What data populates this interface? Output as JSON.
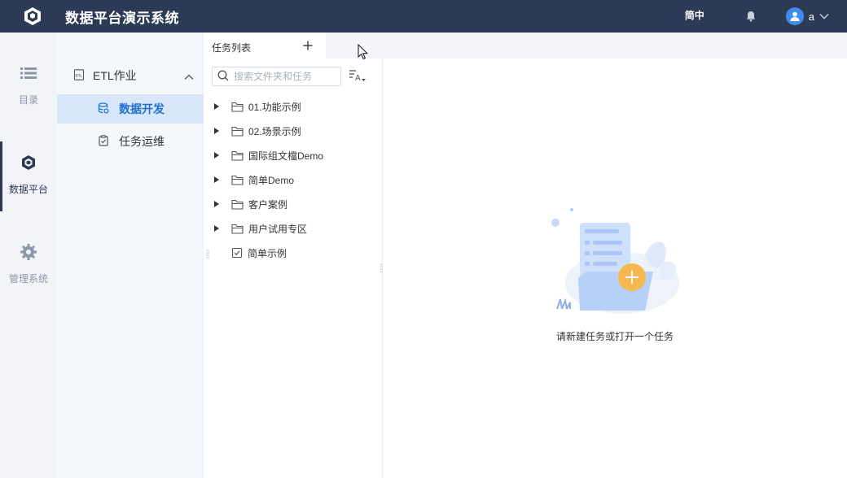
{
  "app": {
    "title": "数据平台演示系统",
    "logo_icon": "cube-logo-icon"
  },
  "header": {
    "language": "简中",
    "bell_icon": "bell-icon",
    "user_name": "a"
  },
  "rail": {
    "items": [
      {
        "label": "目录",
        "icon": "list-icon"
      },
      {
        "label": "数据平台",
        "icon": "cubes-icon",
        "active": true
      },
      {
        "label": "管理系统",
        "icon": "gear-icon"
      }
    ]
  },
  "subnav": {
    "group": {
      "label": "ETL作业",
      "icon": "etl-doc-icon",
      "expanded": true
    },
    "items": [
      {
        "label": "数据开发",
        "icon": "database-icon",
        "active": true
      },
      {
        "label": "任务运维",
        "icon": "clipboard-icon"
      }
    ]
  },
  "taskpanel": {
    "title": "任务列表",
    "search_placeholder": "搜索文件夹和任务",
    "tree": [
      {
        "label": "01.功能示例",
        "type": "folder"
      },
      {
        "label": "02.场景示例",
        "type": "folder"
      },
      {
        "label": "国际组文檔Demo",
        "type": "folder"
      },
      {
        "label": "简单Demo",
        "type": "folder"
      },
      {
        "label": "客户案例",
        "type": "folder"
      },
      {
        "label": "用户试用专区",
        "type": "folder"
      },
      {
        "label": "简单示例",
        "type": "task"
      }
    ]
  },
  "main": {
    "empty_text": "请新建任务或打开一个任务"
  },
  "colors": {
    "topbar": "#2c3a55",
    "accent": "#1f6fd1",
    "active_bg": "#d7e6f8",
    "illustration_plus": "#f8b850"
  }
}
